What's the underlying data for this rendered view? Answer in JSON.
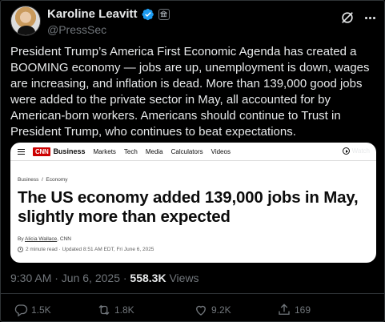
{
  "author": {
    "display_name": "Karoline Leavitt",
    "handle": "@PressSec"
  },
  "tweet": {
    "text": "President Trump’s America First Economic Agenda has created a BOOMING economy — jobs are up, unemployment is down, wages are increasing, and inflation is dead. More than 139,000 good jobs were added to the private sector in May, all accounted for by American-born workers. Americans should continue to Trust in President Trump, who continues to beat expectations.",
    "timestamp": "9:30 AM · Jun 6, 2025 · ",
    "views_count": "558.3K",
    "views_label": " Views"
  },
  "card": {
    "logo": "CNN",
    "section": "Business",
    "nav": [
      "Markets",
      "Tech",
      "Media",
      "Calculators",
      "Videos"
    ],
    "watch_label": "Watch",
    "breadcrumb": "Business  /  Economy",
    "headline": "The US economy added 139,000 jobs in May, slightly more than expected",
    "byline_prefix": "By ",
    "byline_author": "Alicia Wallace",
    "byline_suffix": ", CNN",
    "meta": "2 minute read · Updated 8:51 AM EDT, Fri June 6, 2025"
  },
  "actions": {
    "replies": "1.5K",
    "reposts": "1.8K",
    "likes": "9.2K",
    "bookmarks": "169"
  },
  "colors": {
    "background": "#000000",
    "text": "#e7e9ea",
    "muted": "#71767b",
    "verified": "#1d9bf0",
    "cnn_red": "#cc0000"
  },
  "icons": [
    "verified-badge-icon",
    "government-badge-icon",
    "grok-icon",
    "more-icon",
    "reply-icon",
    "repost-icon",
    "like-icon",
    "share-icon",
    "watch-play-icon",
    "clock-icon",
    "hamburger-icon"
  ]
}
